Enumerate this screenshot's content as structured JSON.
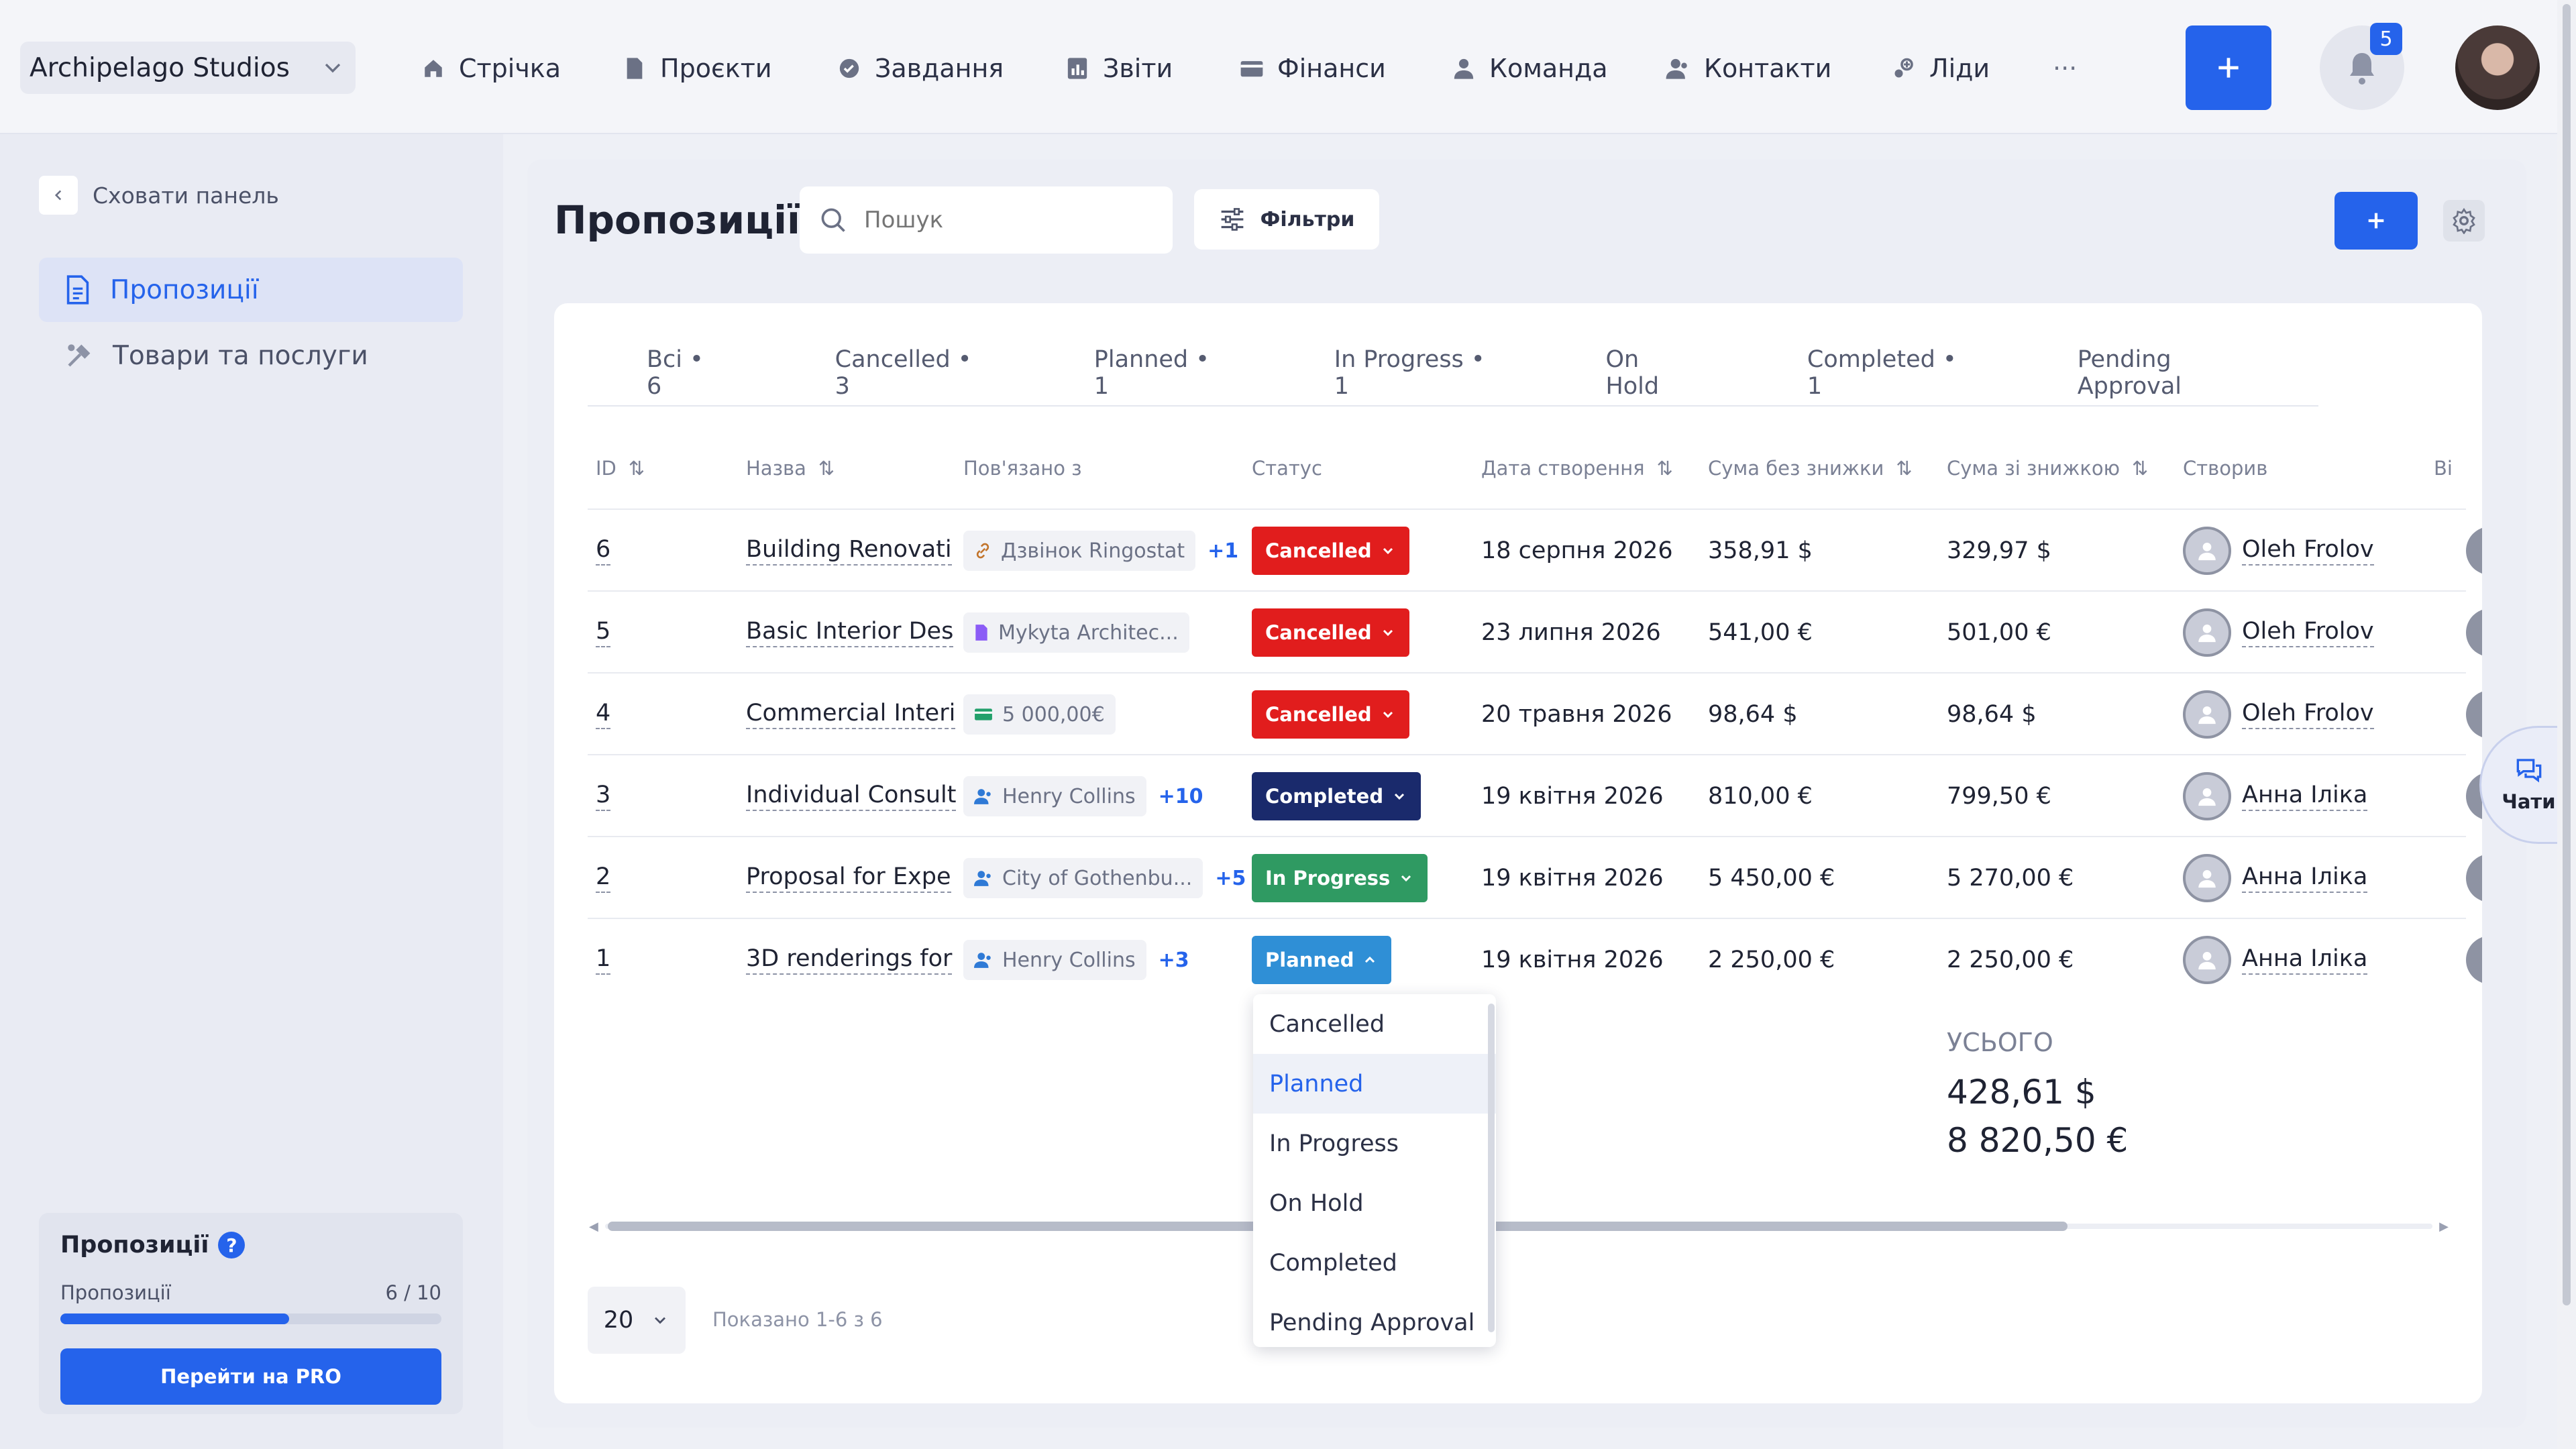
{
  "workspace": {
    "name": "Archipelago Studios"
  },
  "nav": {
    "items": [
      {
        "label": "Стрічка",
        "icon": "home-icon"
      },
      {
        "label": "Проєкти",
        "icon": "document-icon"
      },
      {
        "label": "Завдання",
        "icon": "check-circle-icon"
      },
      {
        "label": "Звіти",
        "icon": "report-icon"
      },
      {
        "label": "Фінанси",
        "icon": "wallet-icon"
      },
      {
        "label": "Команда",
        "icon": "user-icon"
      },
      {
        "label": "Контакти",
        "icon": "contacts-icon"
      },
      {
        "label": "Ліди",
        "icon": "leads-icon"
      }
    ],
    "more": "···",
    "notifications_count": "5"
  },
  "sidebar": {
    "hide_label": "Сховати панель",
    "items": [
      {
        "label": "Пропозиції",
        "active": true
      },
      {
        "label": "Товари та послуги",
        "active": false
      }
    ],
    "quota": {
      "title": "Пропозиції",
      "label": "Пропозиції",
      "count": "6 / 10",
      "used": 6,
      "limit": 10,
      "button": "Перейти на PRO"
    }
  },
  "page": {
    "title": "Пропозиції",
    "search_placeholder": "Пошук",
    "filters_label": "Фільтри"
  },
  "tabs": [
    {
      "label": "Всі • 6"
    },
    {
      "label": "Cancelled • 3"
    },
    {
      "label": "Planned • 1"
    },
    {
      "label": "In Progress • 1"
    },
    {
      "label": "On Hold"
    },
    {
      "label": "Completed • 1"
    },
    {
      "label": "Pending Approval"
    }
  ],
  "table": {
    "headers": {
      "id": "ID",
      "name": "Назва",
      "related": "Пов'язано з",
      "status": "Статус",
      "created": "Дата створення",
      "sum": "Сума без знижки",
      "sum_discount": "Сума зі знижкою",
      "author": "Створив",
      "extra": "Ві"
    },
    "rows": [
      {
        "id": "6",
        "name": "Building Renovati",
        "related": "Дзвінок Ringostat",
        "related_icon": "link-icon",
        "more": "+1",
        "status": "Cancelled",
        "created": "18 серпня 2026",
        "sum": "358,91 $",
        "sum_discount": "329,97 $",
        "author": "Oleh Frolov"
      },
      {
        "id": "5",
        "name": "Basic Interior Des",
        "related": "Mykyta Architec...",
        "related_icon": "file-icon",
        "more": "",
        "status": "Cancelled",
        "created": "23 липня 2026",
        "sum": "541,00 €",
        "sum_discount": "501,00 €",
        "author": "Oleh Frolov"
      },
      {
        "id": "4",
        "name": "Commercial Interi",
        "related": "5 000,00€",
        "related_icon": "money-icon",
        "more": "",
        "status": "Cancelled",
        "created": "20 травня 2026",
        "sum": "98,64 $",
        "sum_discount": "98,64 $",
        "author": "Oleh Frolov"
      },
      {
        "id": "3",
        "name": "Individual Consult",
        "related": "Henry Collins",
        "related_icon": "person-icon",
        "more": "+10",
        "status": "Completed",
        "created": "19 квітня 2026",
        "sum": "810,00 €",
        "sum_discount": "799,50 €",
        "author": "Анна Іліка"
      },
      {
        "id": "2",
        "name": "Proposal for Expe",
        "related": "City of Gothenbu...",
        "related_icon": "person-icon",
        "more": "+5",
        "status": "In Progress",
        "created": "19 квітня 2026",
        "sum": "5 450,00 €",
        "sum_discount": "5 270,00 €",
        "author": "Анна Іліка"
      },
      {
        "id": "1",
        "name": "3D renderings for",
        "related": "Henry Collins",
        "related_icon": "person-icon",
        "more": "+3",
        "status": "Planned",
        "created": "19 квітня 2026",
        "sum": "2 250,00 €",
        "sum_discount": "2 250,00 €",
        "author": "Анна Іліка"
      }
    ],
    "total_label": "УСЬОГО",
    "totals": [
      "428,61 $",
      "8 820,50 €"
    ]
  },
  "status_colors": {
    "Cancelled": "#e11d1d",
    "Completed": "#1a2a6c",
    "In Progress": "#2f9a62",
    "Planned": "#2f8fd6"
  },
  "dropdown": {
    "options": [
      "Cancelled",
      "Planned",
      "In Progress",
      "On Hold",
      "Completed",
      "Pending Approval"
    ],
    "selected": "Planned"
  },
  "pagination": {
    "page_size": "20",
    "shown": "Показано 1-6 з 6"
  },
  "chats": {
    "label": "Чати"
  }
}
